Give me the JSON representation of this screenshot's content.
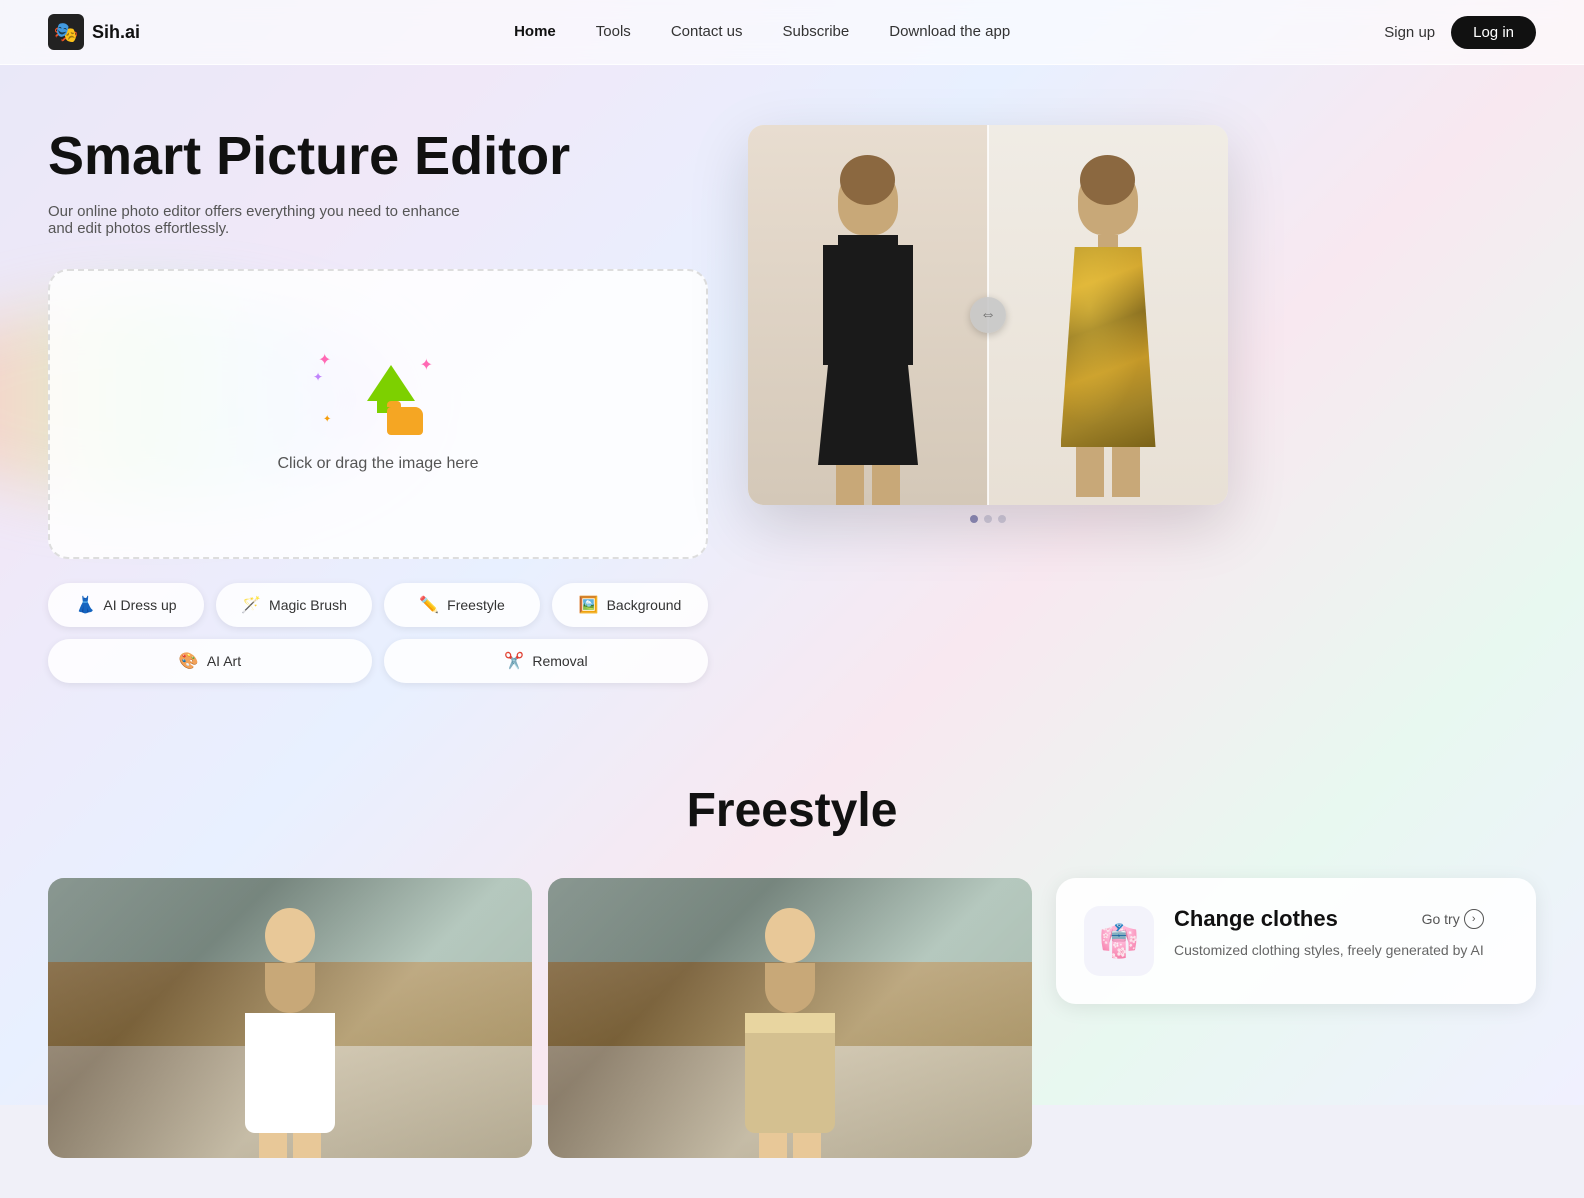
{
  "brand": {
    "name": "Sih.ai",
    "logo_emoji": "🎭"
  },
  "nav": {
    "links": [
      {
        "label": "Home",
        "active": true
      },
      {
        "label": "Tools",
        "active": false
      },
      {
        "label": "Contact us",
        "active": false
      },
      {
        "label": "Subscribe",
        "active": false
      },
      {
        "label": "Download the app",
        "active": false
      }
    ],
    "signup_label": "Sign up",
    "login_label": "Log in"
  },
  "hero": {
    "title": "Smart Picture Editor",
    "subtitle": "Our online photo editor offers everything you need to enhance and edit photos effortlessly.",
    "upload_text": "Click or drag the image here",
    "comparison_dots": [
      {
        "active": true
      },
      {
        "active": false
      },
      {
        "active": false
      }
    ]
  },
  "tools": [
    {
      "id": "ai-dress-up",
      "label": "AI Dress up",
      "icon": "👗"
    },
    {
      "id": "magic-brush",
      "label": "Magic Brush",
      "icon": "🪄"
    },
    {
      "id": "freestyle",
      "label": "Freestyle",
      "icon": "✏️"
    },
    {
      "id": "background",
      "label": "Background",
      "icon": "🖼️"
    },
    {
      "id": "ai-art",
      "label": "AI Art",
      "icon": "🎨"
    },
    {
      "id": "removal",
      "label": "Removal",
      "icon": "✂️"
    }
  ],
  "freestyle_section": {
    "title": "Freestyle",
    "card": {
      "icon": "👘",
      "title": "Change clothes",
      "go_try": "Go try",
      "description": "Customized clothing styles, freely generated by AI"
    }
  }
}
